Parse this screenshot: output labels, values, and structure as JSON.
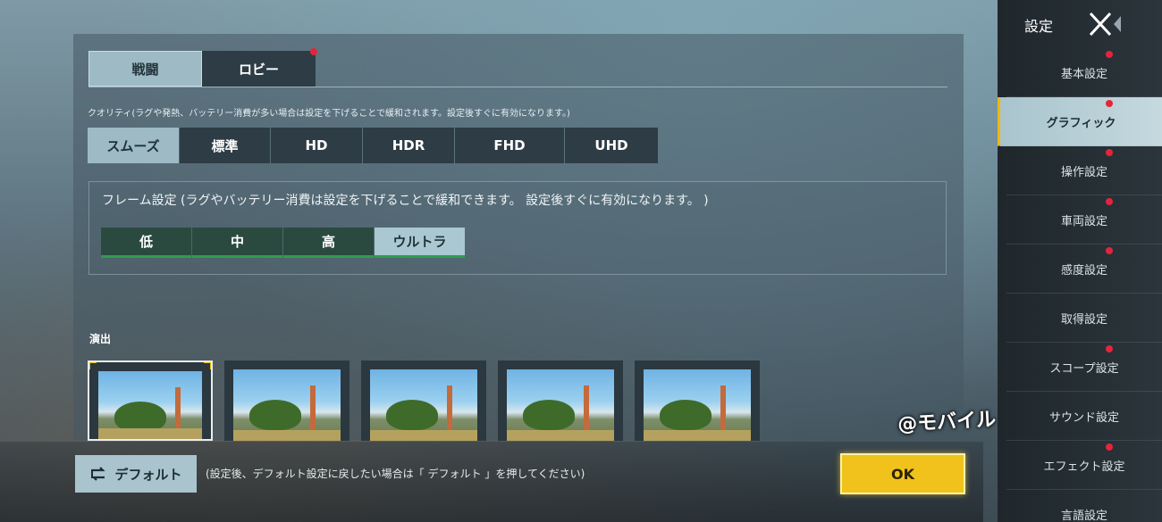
{
  "tabs": [
    {
      "label": "戦闘",
      "active": true
    },
    {
      "label": "ロビー",
      "active": false,
      "badge": true
    }
  ],
  "quality": {
    "note": "クオリティ(ラグや発熱、バッテリー消費が多い場合は設定を下げることで緩和されます。設定後すぐに有効になります。)",
    "options": [
      "スムーズ",
      "標準",
      "HD",
      "HDR",
      "FHD",
      "UHD"
    ],
    "selected": "スムーズ"
  },
  "frame": {
    "title": "フレーム設定 (ラグやバッテリー消費は設定を下げることで緩和できます。 設定後すぐに有効になります。 )",
    "options": [
      "低",
      "中",
      "高",
      "ウルトラ"
    ],
    "selected": "ウルトラ"
  },
  "effects": {
    "label": "演出",
    "thumbnails": 5,
    "selected_index": 0
  },
  "footer": {
    "default_label": "デフォルト",
    "default_note": "(設定後、デフォルト設定に戻したい場合は「 デフォルト 」を押してください)",
    "ok_label": "OK"
  },
  "watermark": "@モバイルドットコム",
  "sidebar": {
    "title": "設定",
    "items": [
      {
        "label": "基本設定",
        "badge": true
      },
      {
        "label": "グラフィック",
        "badge": true,
        "active": true
      },
      {
        "label": "操作設定",
        "badge": true
      },
      {
        "label": "車両設定",
        "badge": true
      },
      {
        "label": "感度設定",
        "badge": true
      },
      {
        "label": "取得設定",
        "badge": false
      },
      {
        "label": "スコープ設定",
        "badge": true
      },
      {
        "label": "サウンド設定",
        "badge": false
      },
      {
        "label": "エフェクト設定",
        "badge": true
      },
      {
        "label": "言語設定",
        "badge": false
      }
    ]
  },
  "colors": {
    "accent": "#f0b90b",
    "badge": "#e5243b",
    "frame_underline": "#2f9d4d"
  }
}
